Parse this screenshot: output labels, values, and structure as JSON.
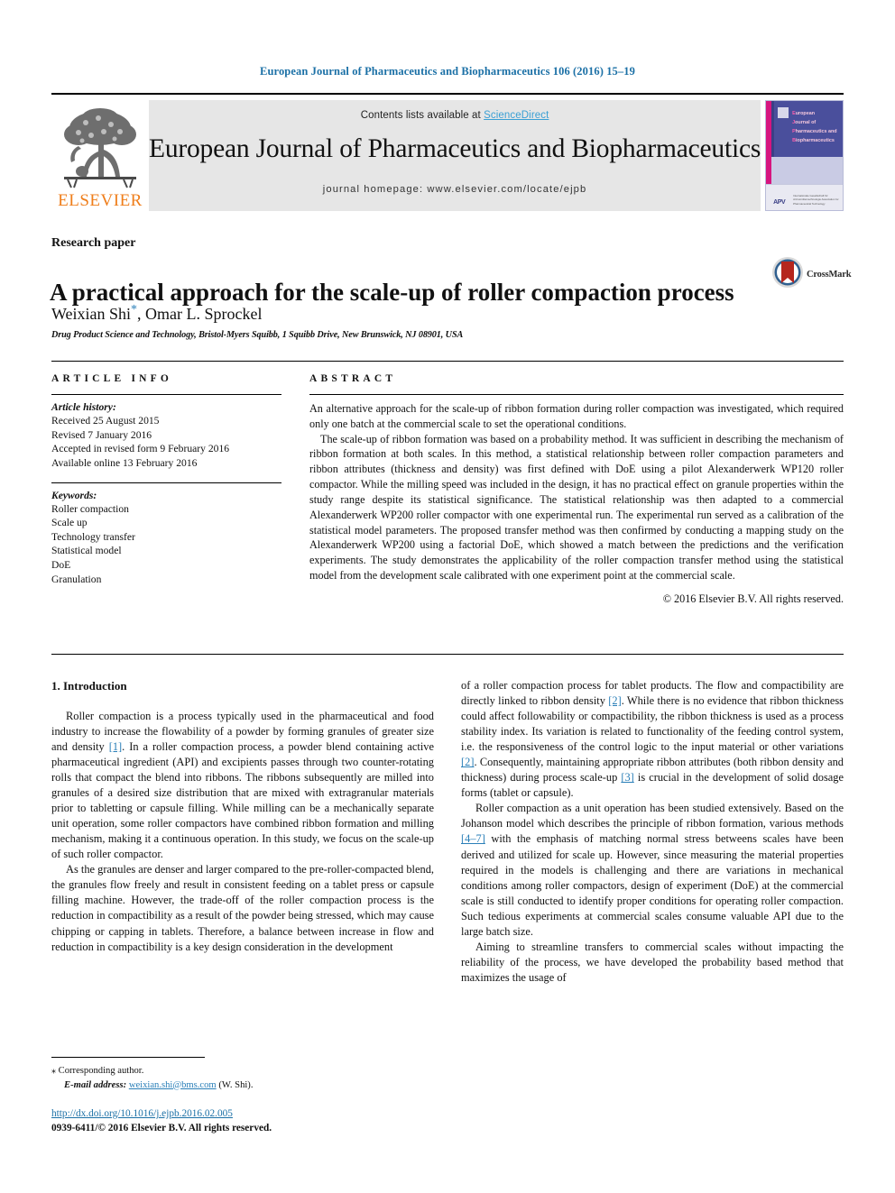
{
  "running_head": "European Journal of Pharmaceutics and Biopharmaceutics 106 (2016) 15–19",
  "masthead": {
    "contents_prefix": "Contents lists available at ",
    "sciencedirect": "ScienceDirect",
    "journal_title": "European Journal of Pharmaceutics and Biopharmaceutics",
    "homepage": "journal homepage: www.elsevier.com/locate/ejpb",
    "publisher_wordmark": "ELSEVIER",
    "publisher_logo_icon": "elsevier-tree-icon",
    "cover": {
      "line1": "European",
      "line2": "Journal of",
      "line3": "Pharmaceutics and",
      "line4": "Biopharmaceutics",
      "official": "Official Journal of",
      "apv": "APV",
      "apv_sub": "Internationale Gesellschaft für Arzneimittel-technologie Association for Pharmaceutical Technology"
    }
  },
  "article": {
    "kind": "Research paper",
    "title": "A practical approach for the scale-up of roller compaction process",
    "authors": "Weixian Shi",
    "authors_rest": ", Omar L. Sprockel",
    "corresponding_marker": "*",
    "affiliation": "Drug Product Science and Technology, Bristol-Myers Squibb, 1 Squibb Drive, New Brunswick, NJ 08901, USA",
    "crossmark_label": "CrossMark"
  },
  "info": {
    "heading": "ARTICLE INFO",
    "history_label": "Article history:",
    "history": [
      "Received 25 August 2015",
      "Revised 7 January 2016",
      "Accepted in revised form 9 February 2016",
      "Available online 13 February 2016"
    ],
    "keywords_label": "Keywords:",
    "keywords": [
      "Roller compaction",
      "Scale up",
      "Technology transfer",
      "Statistical model",
      "DoE",
      "Granulation"
    ]
  },
  "abstract": {
    "heading": "ABSTRACT",
    "paragraphs": [
      "An alternative approach for the scale-up of ribbon formation during roller compaction was investigated, which required only one batch at the commercial scale to set the operational conditions.",
      "The scale-up of ribbon formation was based on a probability method. It was sufficient in describing the mechanism of ribbon formation at both scales. In this method, a statistical relationship between roller compaction parameters and ribbon attributes (thickness and density) was first defined with DoE using a pilot Alexanderwerk WP120 roller compactor. While the milling speed was included in the design, it has no practical effect on granule properties within the study range despite its statistical significance. The statistical relationship was then adapted to a commercial Alexanderwerk WP200 roller compactor with one experimental run. The experimental run served as a calibration of the statistical model parameters. The proposed transfer method was then confirmed by conducting a mapping study on the Alexanderwerk WP200 using a factorial DoE, which showed a match between the predictions and the verification experiments. The study demonstrates the applicability of the roller compaction transfer method using the statistical model from the development scale calibrated with one experiment point at the commercial scale."
    ],
    "copyright": "© 2016 Elsevier B.V. All rights reserved."
  },
  "body": {
    "section_number_title": "1. Introduction",
    "left_paragraphs": [
      "Roller compaction is a process typically used in the pharmaceutical and food industry to increase the flowability of a powder by forming granules of greater size and density [1]. In a roller compaction process, a powder blend containing active pharmaceutical ingredient (API) and excipients passes through two counter-rotating rolls that compact the blend into ribbons. The ribbons subsequently are milled into granules of a desired size distribution that are mixed with extragranular materials prior to tabletting or capsule filling. While milling can be a mechanically separate unit operation, some roller compactors have combined ribbon formation and milling mechanism, making it a continuous operation. In this study, we focus on the scale-up of such roller compactor.",
      "As the granules are denser and larger compared to the pre-roller-compacted blend, the granules flow freely and result in consistent feeding on a tablet press or capsule filling machine. However, the trade-off of the roller compaction process is the reduction in compactibility as a result of the powder being stressed, which may cause chipping or capping in tablets. Therefore, a balance between increase in flow and reduction in compactibility is a key design consideration in the development"
    ],
    "right_paragraphs": [
      "of a roller compaction process for tablet products. The flow and compactibility are directly linked to ribbon density [2]. While there is no evidence that ribbon thickness could affect followability or compactibility, the ribbon thickness is used as a process stability index. Its variation is related to functionality of the feeding control system, i.e. the responsiveness of the control logic to the input material or other variations [2]. Consequently, maintaining appropriate ribbon attributes (both ribbon density and thickness) during process scale-up [3] is crucial in the development of solid dosage forms (tablet or capsule).",
      "Roller compaction as a unit operation has been studied extensively. Based on the Johanson model which describes the principle of ribbon formation, various methods [4–7] with the emphasis of matching normal stress betweens scales have been derived and utilized for scale up. However, since measuring the material properties required in the models is challenging and there are variations in mechanical conditions among roller compactors, design of experiment (DoE) at the commercial scale is still conducted to identify proper conditions for operating roller compaction. Such tedious experiments at commercial scales consume valuable API due to the large batch size.",
      "Aiming to streamline transfers to commercial scales without impacting the reliability of the process, we have developed the probability based method that maximizes the usage of"
    ]
  },
  "footnotes": {
    "corresponding": "Corresponding author.",
    "email_label": "E-mail address:",
    "email": "weixian.shi@bms.com",
    "email_suffix": "(W. Shi).",
    "doi": "http://dx.doi.org/10.1016/j.ejpb.2016.02.005",
    "issn": "0939-6411/© 2016 Elsevier B.V. All rights reserved."
  },
  "colors": {
    "link_blue": "#1b70a6",
    "sciencedirect_blue": "#3a9fd4",
    "elsevier_orange": "#ef7e1b",
    "cover_purple": "#4a4f9c",
    "cover_magenta": "#d6157f",
    "crossmark_red": "#b5261e"
  }
}
